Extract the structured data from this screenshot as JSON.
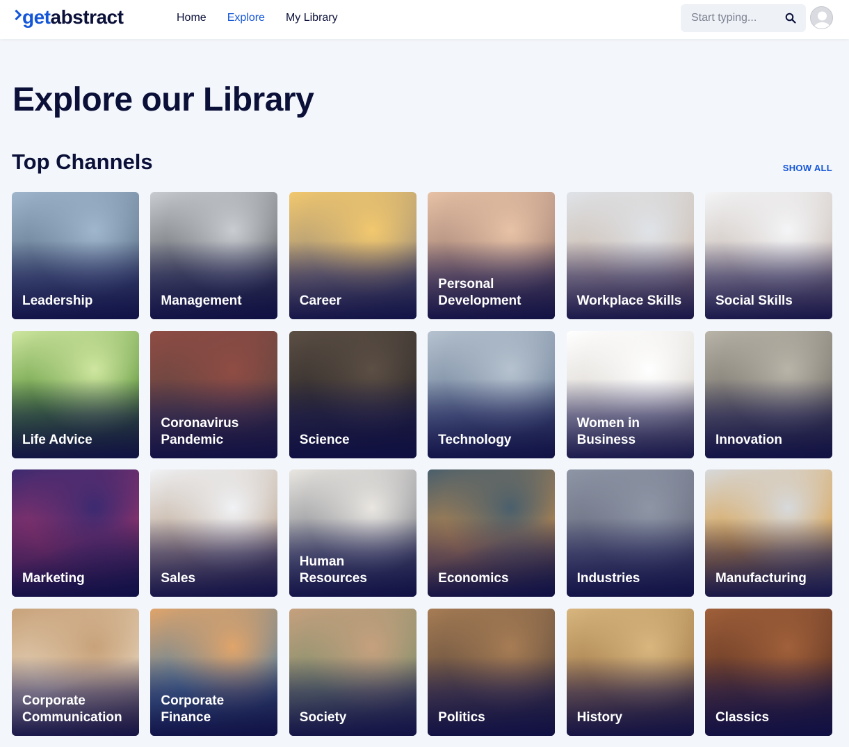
{
  "header": {
    "logo_get": "get",
    "logo_abstract": "abstract",
    "nav": [
      {
        "label": "Home",
        "active": false
      },
      {
        "label": "Explore",
        "active": true
      },
      {
        "label": "My Library",
        "active": false
      }
    ],
    "search_placeholder": "Start typing..."
  },
  "main": {
    "title": "Explore our Library",
    "section_title": "Top Channels",
    "show_all_label": "SHOW ALL",
    "channels": [
      {
        "label": "Leadership",
        "colors": [
          "#9fb6cc",
          "#5a6f86",
          "#2a3550"
        ]
      },
      {
        "label": "Management",
        "colors": [
          "#c9ccd0",
          "#5d6166",
          "#1c1e24"
        ]
      },
      {
        "label": "Career",
        "colors": [
          "#f2c86e",
          "#9a8c7a",
          "#3c4150"
        ]
      },
      {
        "label": "Personal Development",
        "colors": [
          "#e7c2a6",
          "#9b7a70",
          "#40363d"
        ]
      },
      {
        "label": "Workplace Skills",
        "colors": [
          "#dfe3e8",
          "#c9b6a6",
          "#8c6f62"
        ]
      },
      {
        "label": "Social Skills",
        "colors": [
          "#f4f5f7",
          "#c5b8b0",
          "#7e6b66"
        ]
      },
      {
        "label": "Life Advice",
        "colors": [
          "#cfe6a0",
          "#4f8c2e",
          "#1f3814"
        ]
      },
      {
        "label": "Coronavirus Pandemic",
        "colors": [
          "#8f4c44",
          "#5e4440",
          "#2a1f22"
        ]
      },
      {
        "label": "Science",
        "colors": [
          "#5c4f44",
          "#2a2628",
          "#111016"
        ]
      },
      {
        "label": "Technology",
        "colors": [
          "#b6c2cf",
          "#6a7d96",
          "#27324a"
        ]
      },
      {
        "label": "Women in Business",
        "colors": [
          "#ffffff",
          "#d8d3cc",
          "#7c756e"
        ]
      },
      {
        "label": "Innovation",
        "colors": [
          "#b9b4a8",
          "#6e6a63",
          "#2d2b2a"
        ]
      },
      {
        "label": "Marketing",
        "colors": [
          "#3c2a70",
          "#a2346a",
          "#1b1742"
        ]
      },
      {
        "label": "Sales",
        "colors": [
          "#f0f2f5",
          "#b8a08a",
          "#3b3340"
        ]
      },
      {
        "label": "Human Resources",
        "colors": [
          "#e9e6e1",
          "#7d8088",
          "#2b2f3e"
        ]
      },
      {
        "label": "Economics",
        "colors": [
          "#4a5f6c",
          "#c98d4a",
          "#1d2433"
        ]
      },
      {
        "label": "Industries",
        "colors": [
          "#8e96a6",
          "#65687a",
          "#2f3346"
        ]
      },
      {
        "label": "Manufacturing",
        "colors": [
          "#d7d9dc",
          "#d89a3a",
          "#5e6472"
        ]
      },
      {
        "label": "Corporate Communication",
        "colors": [
          "#c8a27a",
          "#e8d8c0",
          "#6e4f38"
        ]
      },
      {
        "label": "Corporate Finance",
        "colors": [
          "#e0a46a",
          "#4f7ea0",
          "#1f3047"
        ]
      },
      {
        "label": "Society",
        "colors": [
          "#c6a07e",
          "#7b8e6a",
          "#3a3446"
        ]
      },
      {
        "label": "Politics",
        "colors": [
          "#a67c54",
          "#5e4a3c",
          "#221d24"
        ]
      },
      {
        "label": "History",
        "colors": [
          "#d8b67e",
          "#9c7444",
          "#3b2c22"
        ]
      },
      {
        "label": "Classics",
        "colors": [
          "#a0603a",
          "#5c3222",
          "#1d1420"
        ]
      }
    ]
  }
}
